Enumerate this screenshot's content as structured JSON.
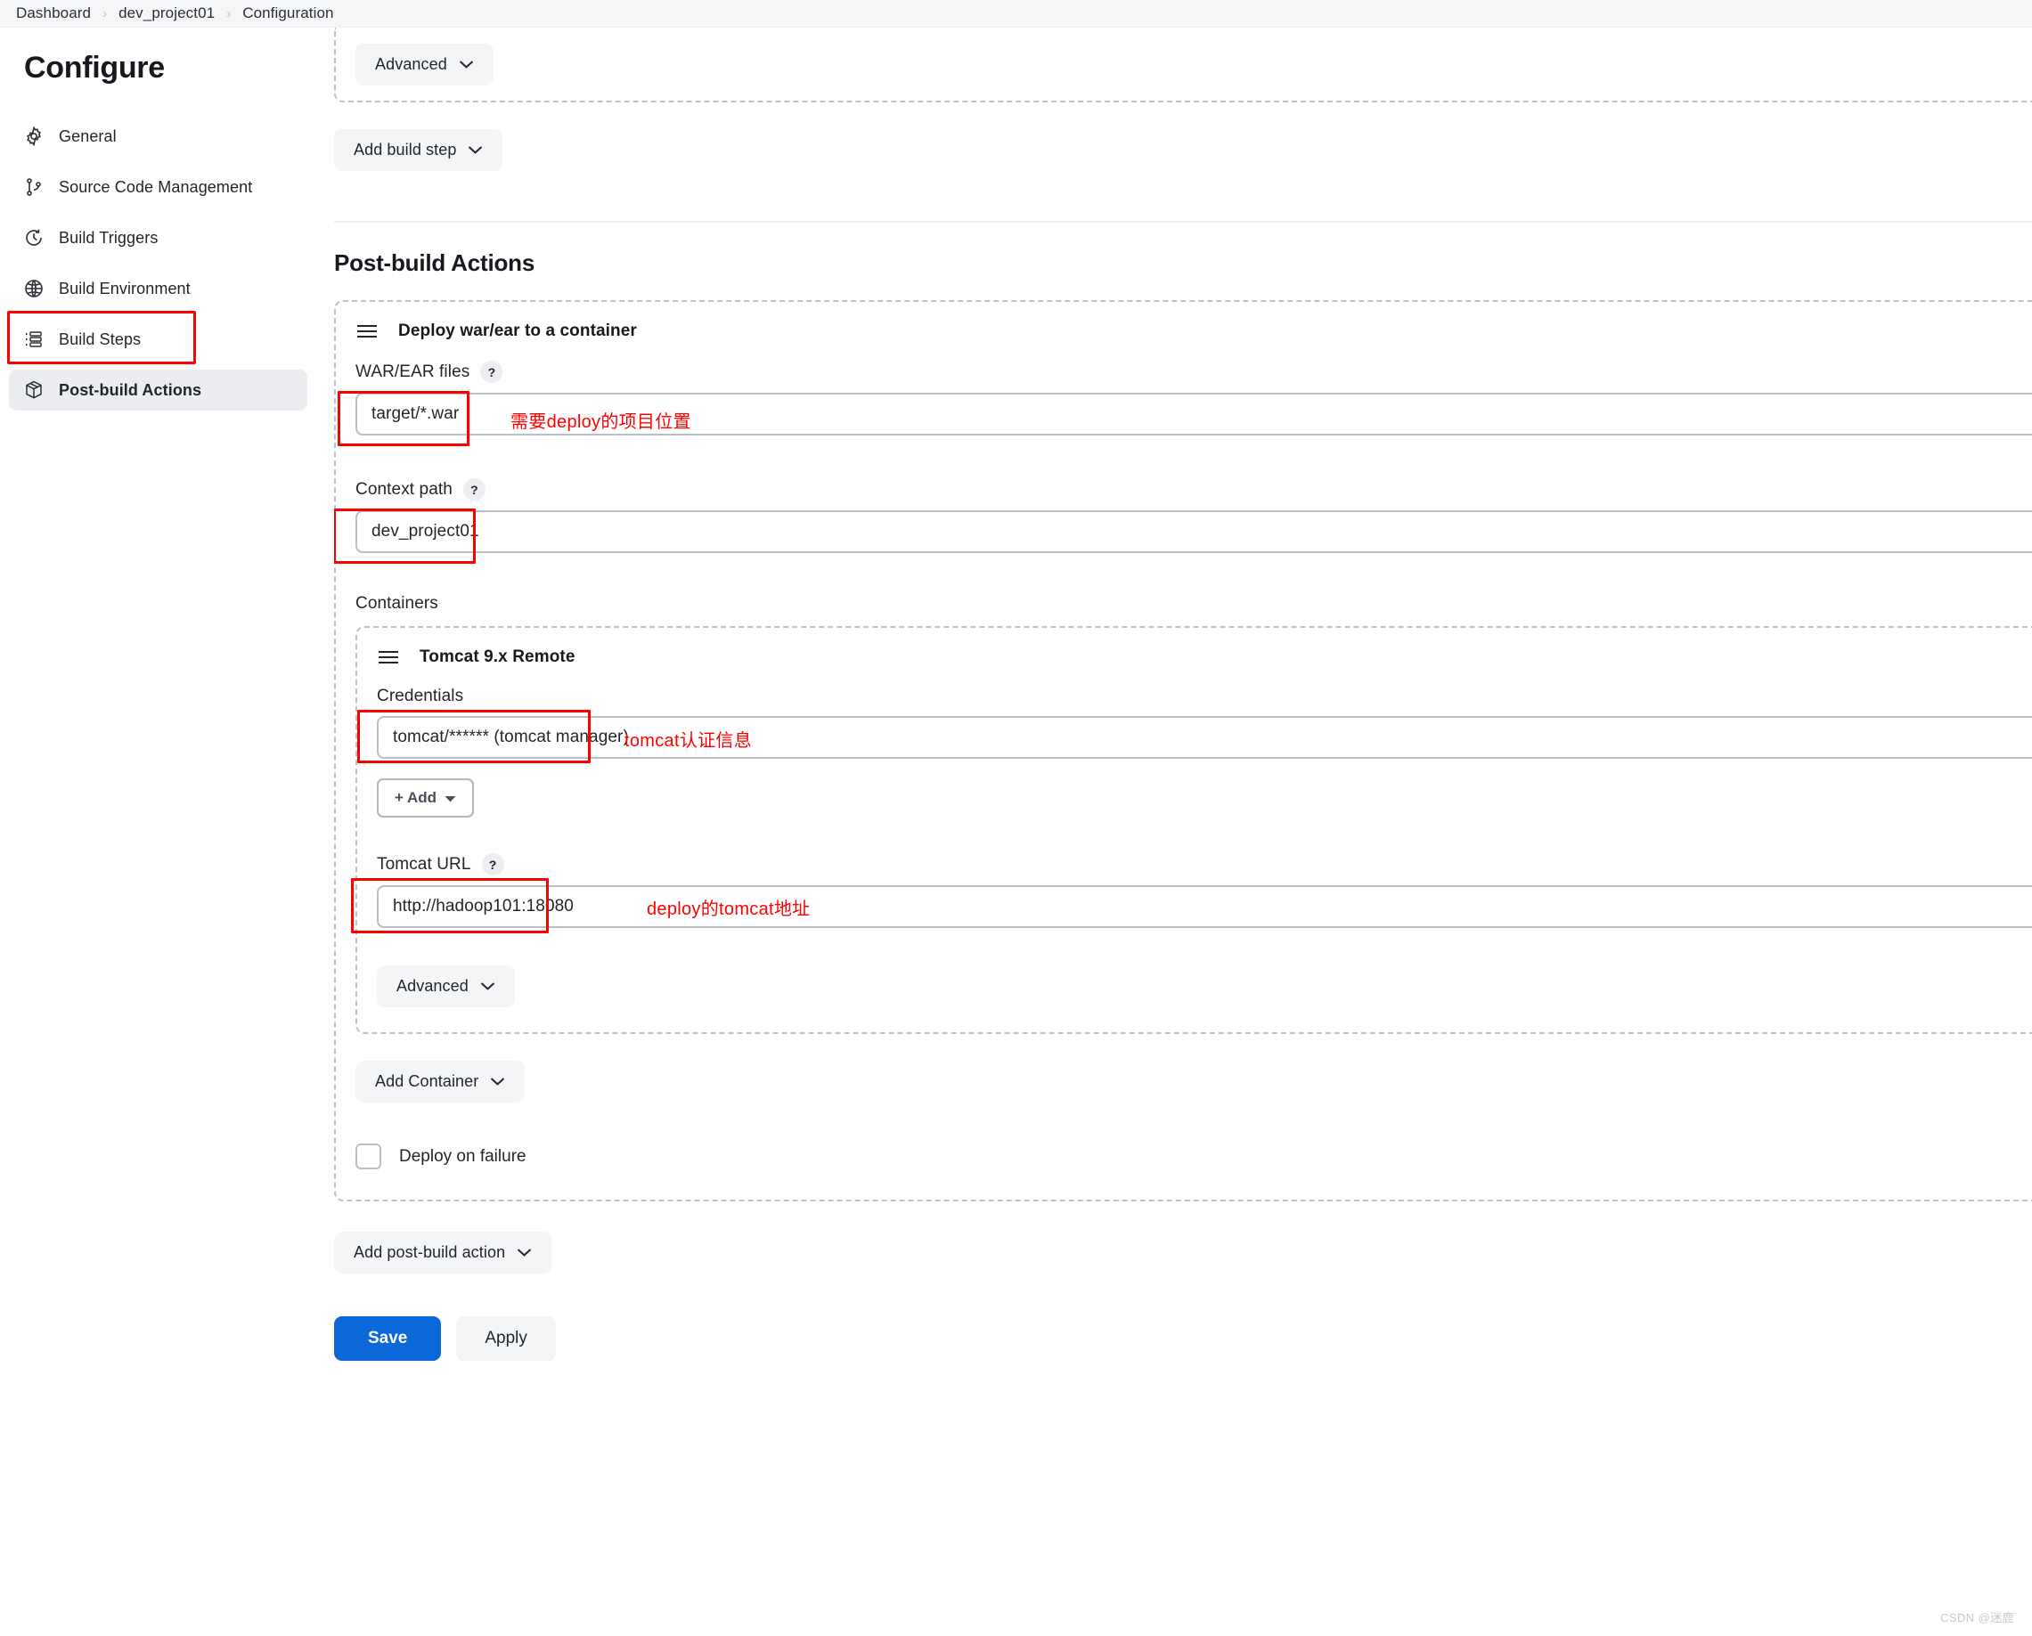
{
  "breadcrumb": {
    "items": [
      "Dashboard",
      "dev_project01",
      "Configuration"
    ],
    "separator": "›"
  },
  "sidebar": {
    "title": "Configure",
    "items": [
      {
        "label": "General",
        "icon": "gear-icon",
        "active": false
      },
      {
        "label": "Source Code Management",
        "icon": "git-branch-icon",
        "active": false
      },
      {
        "label": "Build Triggers",
        "icon": "clock-icon",
        "active": false
      },
      {
        "label": "Build Environment",
        "icon": "globe-icon",
        "active": false
      },
      {
        "label": "Build Steps",
        "icon": "list-icon",
        "active": false
      },
      {
        "label": "Post-build Actions",
        "icon": "package-icon",
        "active": true
      }
    ]
  },
  "main": {
    "top_panel": {
      "advanced_label": "Advanced"
    },
    "add_build_step_label": "Add build step",
    "post_build_section_title": "Post-build Actions",
    "deploy_panel": {
      "title": "Deploy war/ear to a container",
      "war_files": {
        "label": "WAR/EAR files",
        "help": "?",
        "value": "target/*.war"
      },
      "context_path": {
        "label": "Context path",
        "help": "?",
        "value": "dev_project01"
      },
      "containers_label": "Containers",
      "container": {
        "title": "Tomcat 9.x Remote",
        "credentials": {
          "label": "Credentials",
          "value": "tomcat/****** (tomcat manager)"
        },
        "add_button_label": "+ Add",
        "tomcat_url": {
          "label": "Tomcat URL",
          "help": "?",
          "value": "http://hadoop101:18080"
        },
        "advanced_label": "Advanced"
      },
      "add_container_label": "Add Container",
      "deploy_on_failure_label": "Deploy on failure",
      "deploy_on_failure_checked": false
    },
    "add_post_build_action_label": "Add post-build action",
    "save_label": "Save",
    "apply_label": "Apply"
  },
  "annotations": {
    "war_files_note": "需要deploy的项目位置",
    "credentials_note": "tomcat认证信息",
    "tomcat_url_note": "deploy的tomcat地址",
    "color": "#ff0000"
  },
  "watermark": "CSDN @迷鹿"
}
